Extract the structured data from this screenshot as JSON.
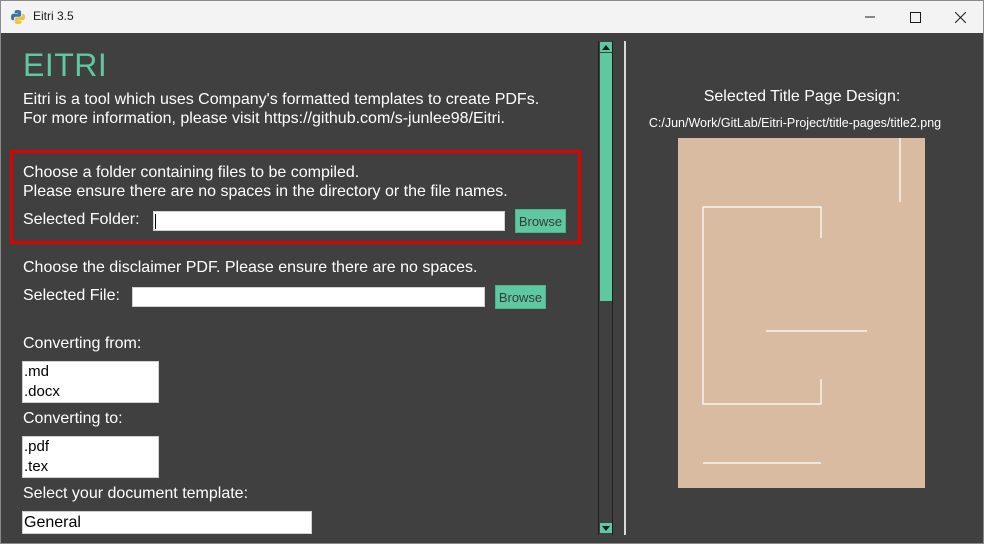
{
  "window": {
    "title": "Eitri 3.5"
  },
  "app": {
    "heading": "EITRI",
    "intro_line1": "Eitri is a tool which uses Company's formatted templates to create PDFs.",
    "intro_line2": "For more information, please visit https://github.com/s-junlee98/Eitri."
  },
  "folder_section": {
    "line1": "Choose a folder containing files to be compiled.",
    "line2": "Please ensure there are no spaces in the directory or the file names.",
    "label": "Selected Folder:",
    "value": "",
    "browse_label": "Browse"
  },
  "disclaimer_section": {
    "line1": "Choose the disclaimer PDF. Please ensure there are no spaces.",
    "label": "Selected File:",
    "value": "",
    "browse_label": "Browse"
  },
  "converting_from": {
    "label": "Converting from:",
    "options": [
      ".md",
      ".docx"
    ]
  },
  "converting_to": {
    "label": "Converting to:",
    "options": [
      ".pdf",
      ".tex"
    ]
  },
  "template": {
    "label": "Select your document template:",
    "value": "General"
  },
  "preview": {
    "title": "Selected Title Page Design:",
    "path": "C:/Jun/Work/GitLab/Eitri-Project/title-pages/title2.png"
  },
  "colors": {
    "accent": "#5ec8a0",
    "background": "#404040",
    "highlight": "#e00000",
    "preview_bg": "#d9bba1"
  }
}
